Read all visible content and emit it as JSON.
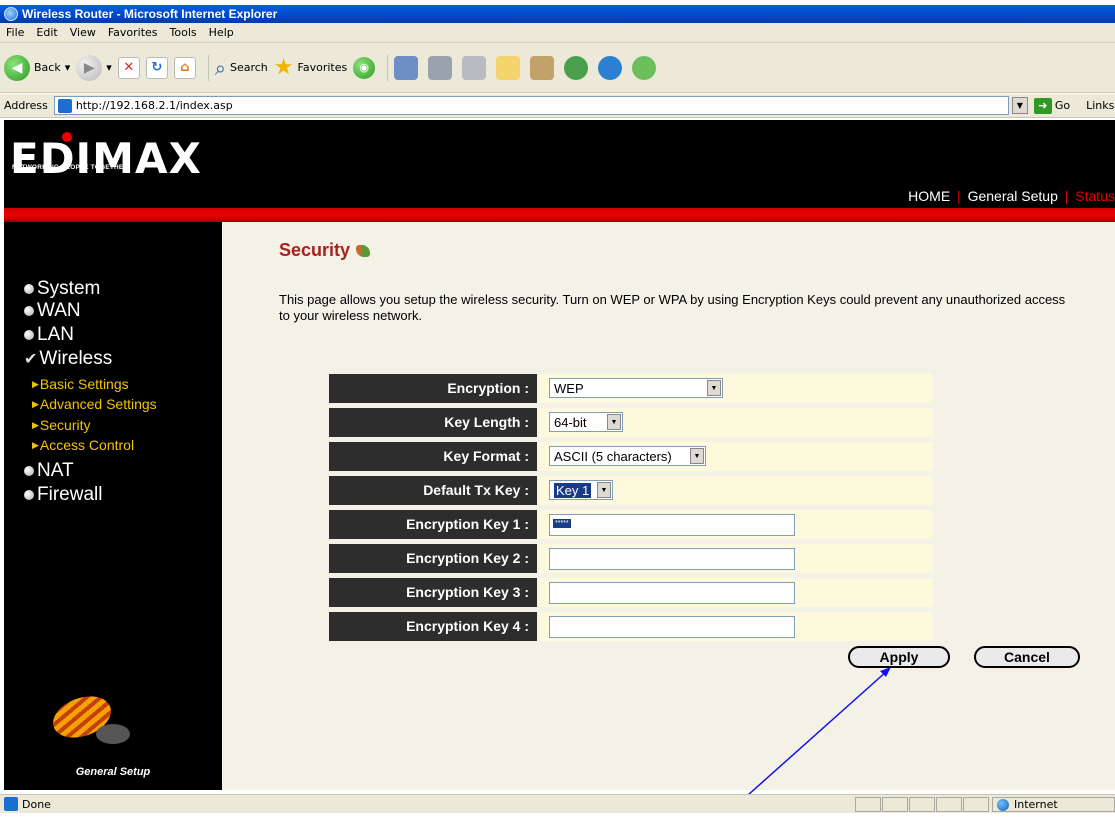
{
  "window": {
    "title": "Wireless Router - Microsoft Internet Explorer",
    "corner_mark": "▲ ▼ | ▲"
  },
  "menu": [
    "File",
    "Edit",
    "View",
    "Favorites",
    "Tools",
    "Help"
  ],
  "toolbar": {
    "back": "Back",
    "search": "Search",
    "favorites": "Favorites"
  },
  "address": {
    "label": "Address",
    "url": "http://192.168.2.1/index.asp",
    "go": "Go",
    "links": "Links"
  },
  "router": {
    "brand": "EDIMAX",
    "tagline": "NETWORKING PEOPLE TOGETHER",
    "nav": {
      "home": "HOME",
      "sep1": "|",
      "general": "General Setup",
      "sep2": "|",
      "status": "Status"
    },
    "sidebar": {
      "items": [
        "System",
        "WAN",
        "LAN",
        "Wireless"
      ],
      "sub": [
        "Basic Settings",
        "Advanced Settings",
        "Security",
        "Access Control"
      ],
      "more": [
        "NAT",
        "Firewall"
      ],
      "footer": "General Setup"
    },
    "page_title": "Security",
    "description": "This page allows you setup the wireless security. Turn on WEP or WPA by using Encryption Keys could prevent any unauthorized access to your wireless network.",
    "form": {
      "encryption": {
        "label": "Encryption :",
        "value": "WEP"
      },
      "key_length": {
        "label": "Key Length :",
        "value": "64-bit"
      },
      "key_format": {
        "label": "Key Format :",
        "value": "ASCII (5 characters)"
      },
      "default_tx": {
        "label": "Default Tx Key :",
        "value": "Key 1"
      },
      "key1": {
        "label": "Encryption Key 1 :",
        "value": "*****"
      },
      "key2": {
        "label": "Encryption Key 2 :",
        "value": ""
      },
      "key3": {
        "label": "Encryption Key 3 :",
        "value": ""
      },
      "key4": {
        "label": "Encryption Key 4 :",
        "value": ""
      }
    },
    "buttons": {
      "apply": "Apply",
      "cancel": "Cancel"
    }
  },
  "status": {
    "text": "Done",
    "zone": "Internet"
  },
  "colors": {
    "accent_red": "#e60000",
    "title_red": "#a82020",
    "link_yellow": "#f2c400"
  }
}
